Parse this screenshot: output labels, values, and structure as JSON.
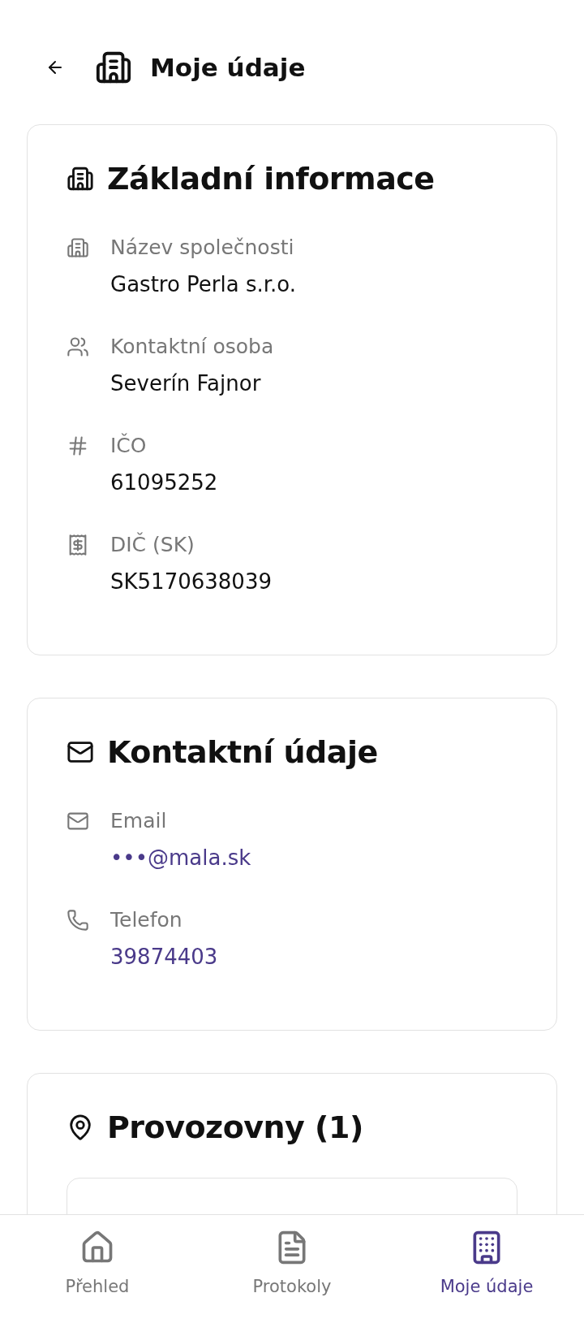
{
  "header": {
    "title": "Moje údaje"
  },
  "sections": [
    {
      "title": "Základní informace",
      "fields": [
        {
          "label": "Název společnosti",
          "value": "Gastro Perla s.r.o.",
          "kind": "text"
        },
        {
          "label": "Kontaktní osoba",
          "value": "Severín Fajnor",
          "kind": "text"
        },
        {
          "label": "IČO",
          "value": "61095252",
          "kind": "text"
        },
        {
          "label": "DIČ (SK)",
          "value": "SK5170638039",
          "kind": "text"
        }
      ]
    },
    {
      "title": "Kontaktní údaje",
      "fields": [
        {
          "label": "Email",
          "value": "•••@mala.sk",
          "kind": "link"
        },
        {
          "label": "Telefon",
          "value": "39874403",
          "kind": "link"
        }
      ]
    },
    {
      "title": "Provozovny (1)"
    }
  ],
  "nav": [
    {
      "label": "Přehled",
      "selected": false
    },
    {
      "label": "Protokoly",
      "selected": false
    },
    {
      "label": "Moje údaje",
      "selected": true
    }
  ]
}
